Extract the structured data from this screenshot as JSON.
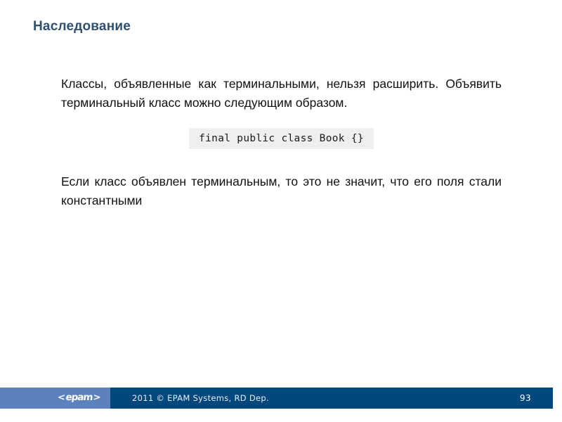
{
  "slide": {
    "title": "Наследование",
    "paragraphs": [
      "Классы, объявленные как терминальными, нельзя расширить. Объявить терминальный класс можно следующим образом.",
      "Если класс объявлен терминальным, то это не значит, что его поля стали константными"
    ],
    "code_snippet": "final public class Book {}"
  },
  "footer": {
    "logo_open_bracket": "<",
    "logo_word": "epam",
    "logo_close_bracket": ">",
    "copyright": "2011 © EPAM Systems, RD Dep.",
    "page_number": "93"
  },
  "colors": {
    "title": "#2f5070",
    "footer_left": "#5c82bd",
    "footer_right": "#004a80",
    "code_background": "#efefef",
    "body_text": "#111111",
    "slide_background": "#ffffff"
  }
}
